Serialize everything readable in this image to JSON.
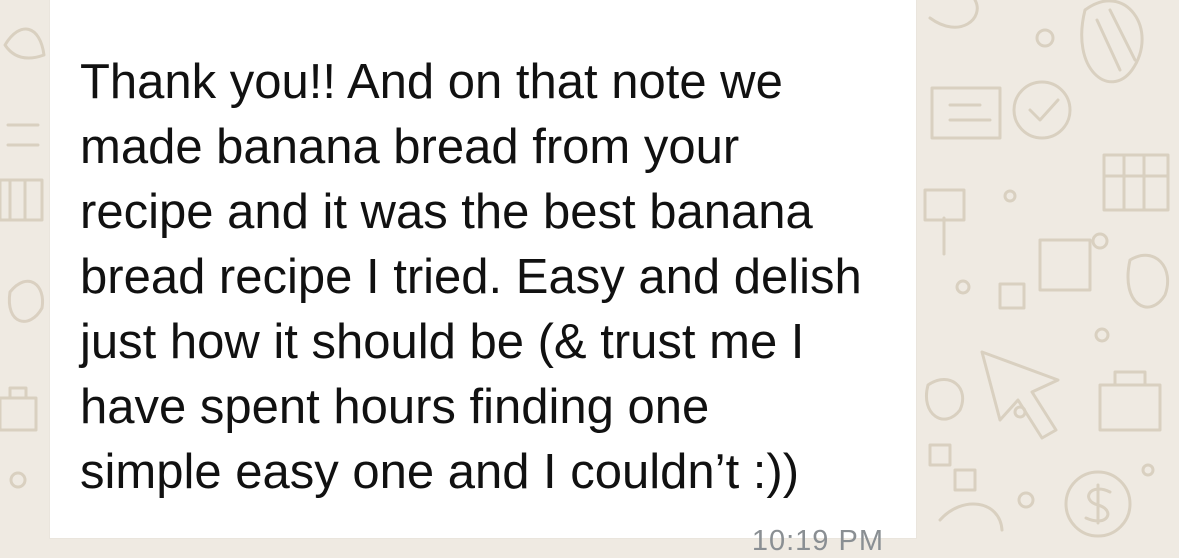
{
  "message": {
    "text": "Thank you!! And on that note we\nmade banana bread from your\nrecipe and it was the best banana\nbread recipe I tried. Easy and delish\njust how it should be (& trust me I\nhave spent hours finding one\nsimple easy one and I couldn’t :))",
    "time": "10:19 PM"
  },
  "colors": {
    "wallpaper": "#efeae2",
    "bubble": "#ffffff",
    "text": "#111111",
    "timestamp": "#8a8f93"
  },
  "icons": [
    "chat-wallpaper-doodle-icons"
  ]
}
